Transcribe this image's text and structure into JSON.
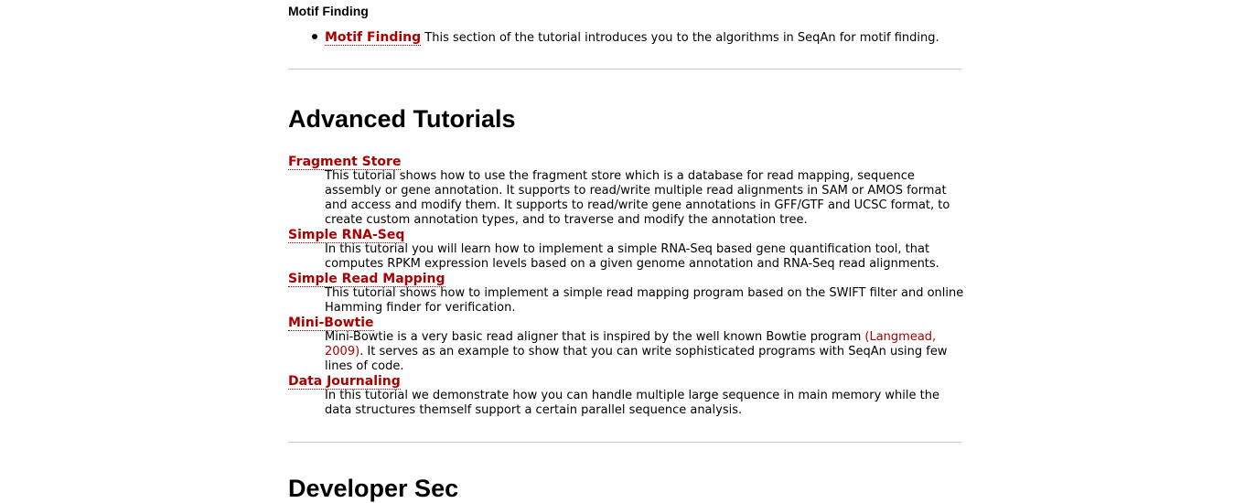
{
  "motif": {
    "heading": "Motif Finding",
    "items": [
      {
        "link": "Motif Finding",
        "text": " This section of the tutorial introduces you to the algorithms in SeqAn for motif finding."
      }
    ]
  },
  "advanced": {
    "title": "Advanced Tutorials",
    "entries": [
      {
        "term": "Fragment Store",
        "desc": "This tutorial shows how to use the fragment store which is a database for read mapping, sequence assembly or gene annotation. It supports to read/write multiple read alignments in SAM or AMOS format and access and modify them. It supports to read/write gene annotations in GFF/GTF and UCSC format, to create custom annotation types, and to traverse and modify the annotation tree."
      },
      {
        "term": "Simple RNA-Seq",
        "desc": "In this tutorial you will learn how to implement a simple RNA-Seq based gene quantification tool, that computes RPKM expression levels based on a given genome annotation and RNA-Seq read alignments."
      },
      {
        "term": "Simple Read Mapping",
        "desc": "This tutorial shows how to implement a simple read mapping program based on the SWIFT filter and online Hamming finder for verification."
      },
      {
        "term": "Mini-Bowtie",
        "desc_before": "Mini-Bowtie is a very basic read aligner that is inspired by the well known Bowtie program ",
        "citation": "(Langmead, 2009)",
        "desc_after": ". It serves as an example to show that you can write sophisticated programs with SeqAn using few lines of code."
      },
      {
        "term": "Data Journaling",
        "desc": "In this tutorial we demonstrate how you can handle multiple large sequence in main memory while the data structures themself support a certain parallel sequence analysis."
      }
    ]
  },
  "next_section": {
    "title": "Developer Sec"
  },
  "colors": {
    "link": "#aa0000",
    "rule": "#c8c8c8"
  }
}
